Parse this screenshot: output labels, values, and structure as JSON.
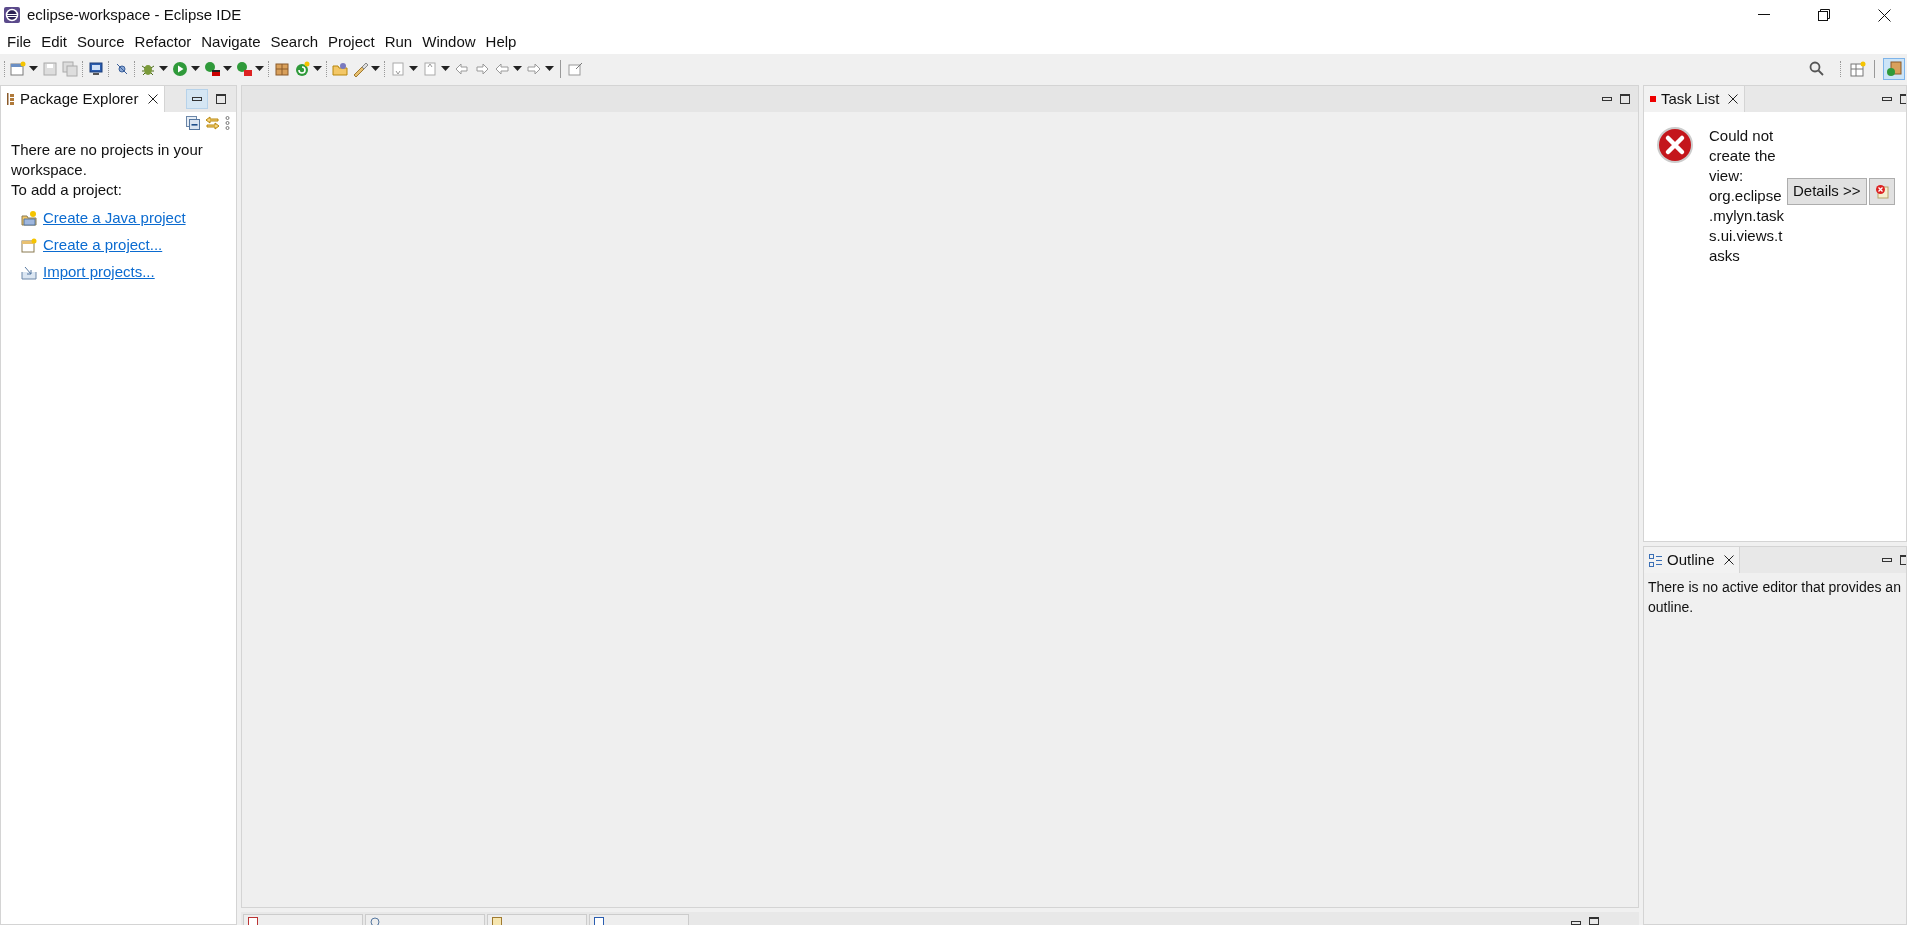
{
  "window": {
    "title": "eclipse-workspace - Eclipse IDE"
  },
  "menu": [
    "File",
    "Edit",
    "Source",
    "Refactor",
    "Navigate",
    "Search",
    "Project",
    "Run",
    "Window",
    "Help"
  ],
  "package_explorer": {
    "tab": "Package Explorer",
    "message": "There are no projects in your workspace.",
    "hint": "To add a project:",
    "links": [
      {
        "label": "Create a Java project",
        "kind": "java"
      },
      {
        "label": "Create a project...",
        "kind": "project"
      },
      {
        "label": "Import projects...",
        "kind": "import"
      }
    ]
  },
  "task_list": {
    "tab": "Task List",
    "error": "Could not create the view: org.eclipse.mylyn.tasks.ui.views.tasks",
    "button": "Details >>"
  },
  "outline": {
    "tab": "Outline",
    "message": "There is no active editor that provides an outline."
  }
}
